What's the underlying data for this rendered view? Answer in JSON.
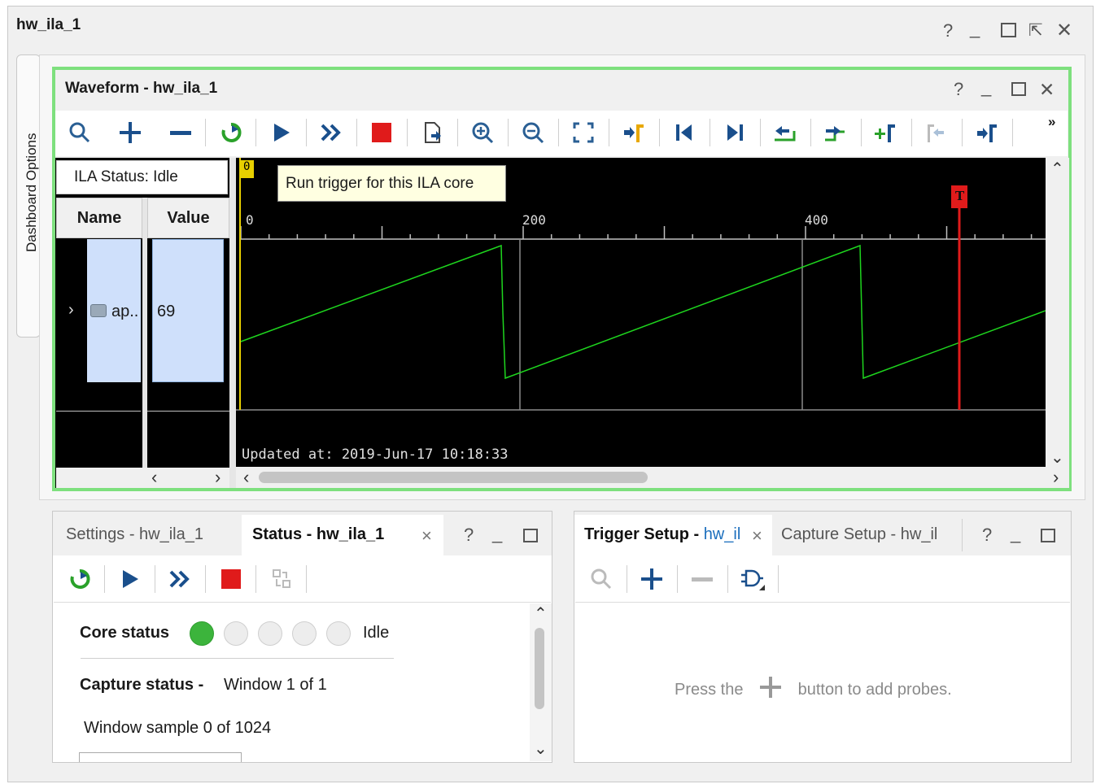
{
  "window": {
    "title": "hw_ila_1"
  },
  "window_controls": {
    "help": "?",
    "minimize": "_"
  },
  "dashboard_tab": {
    "label": "Dashboard Options"
  },
  "waveform": {
    "title": "Waveform - hw_ila_1",
    "help": "?",
    "overflow": "»",
    "status": "ILA Status: Idle",
    "columns": {
      "name": "Name",
      "value": "Value"
    },
    "signal": {
      "name": "ap..",
      "value": "69"
    },
    "time_marker": "0",
    "ruler_ticks": [
      "0",
      "200",
      "400"
    ],
    "trigger_marker": "T",
    "updated_text": "Updated at: 2019-Jun-17 10:18:33",
    "tooltip": "Run trigger for this ILA core",
    "colors": {
      "wave": "#1ed51e",
      "trigger": "#e01b1b",
      "cursor": "#e8d000",
      "frame": "#7ee07e"
    }
  },
  "toolbar_icons": [
    "search-icon",
    "plus-icon",
    "minus-icon",
    "run-trigger-immediate-icon",
    "run-trigger-icon",
    "auto-retrigger-icon",
    "stop-icon",
    "export-icon",
    "zoom-in-icon",
    "zoom-out-icon",
    "zoom-fit-icon",
    "go-to-cursor-icon",
    "go-to-start-icon",
    "go-to-end-icon",
    "previous-transition-icon",
    "next-transition-icon",
    "add-marker-icon",
    "previous-marker-icon",
    "next-marker-icon"
  ],
  "status_panel": {
    "tabs": {
      "settings": "Settings - hw_ila_1",
      "status": "Status - hw_ila_1",
      "close": "×"
    },
    "help": "?",
    "core_status_label": "Core status",
    "core_status_value": "Idle",
    "capture_status_label": "Capture status -",
    "capture_status_value": "Window 1 of 1",
    "window_sample": "Window sample 0 of 1024"
  },
  "trigger_panel": {
    "tabs": {
      "trigger_prefix": "Trigger Setup - ",
      "trigger_suffix": "hw_il",
      "close": "×",
      "capture": "Capture Setup - hw_il"
    },
    "help": "?",
    "hint_prefix": "Press the",
    "hint_suffix": "button to add probes."
  }
}
